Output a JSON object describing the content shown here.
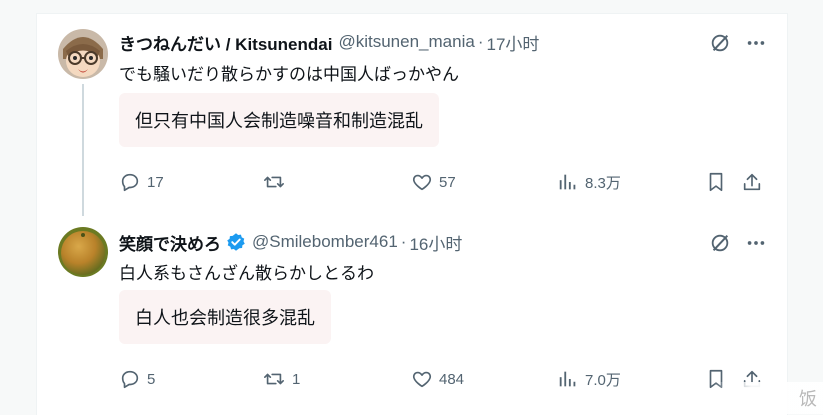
{
  "tweets": [
    {
      "name": "きつねんだい / Kitsunendai",
      "handle": "@kitsunen_mania",
      "separator": "·",
      "time": "17小时",
      "text": "でも騒いだり散らかすのは中国人ばっかやん",
      "translation": "但只有中国人会制造噪音和制造混乱",
      "verified": false,
      "stats": {
        "replies": "17",
        "retweets": "",
        "likes": "57",
        "views": "8.3万"
      }
    },
    {
      "name": "笑顔で決めろ",
      "handle": "@Smilebomber461",
      "separator": "·",
      "time": "16小时",
      "text": "白人系もさんざん散らかしとるわ",
      "translation": "白人也会制造很多混乱",
      "verified": true,
      "stats": {
        "replies": "5",
        "retweets": "1",
        "likes": "484",
        "views": "7.0万"
      }
    }
  ],
  "icons": {
    "grok": "grok-icon",
    "more": "more-icon",
    "reply": "reply-icon",
    "retweet": "retweet-icon",
    "like": "like-icon",
    "views": "views-icon",
    "bookmark": "bookmark-icon",
    "share": "share-icon",
    "verified": "verified-badge-icon"
  },
  "colors": {
    "verified": "#1d9bf0",
    "muted": "#536471",
    "translation_bg": "#fbf3f3"
  },
  "watermark": {
    "text": "饭"
  }
}
